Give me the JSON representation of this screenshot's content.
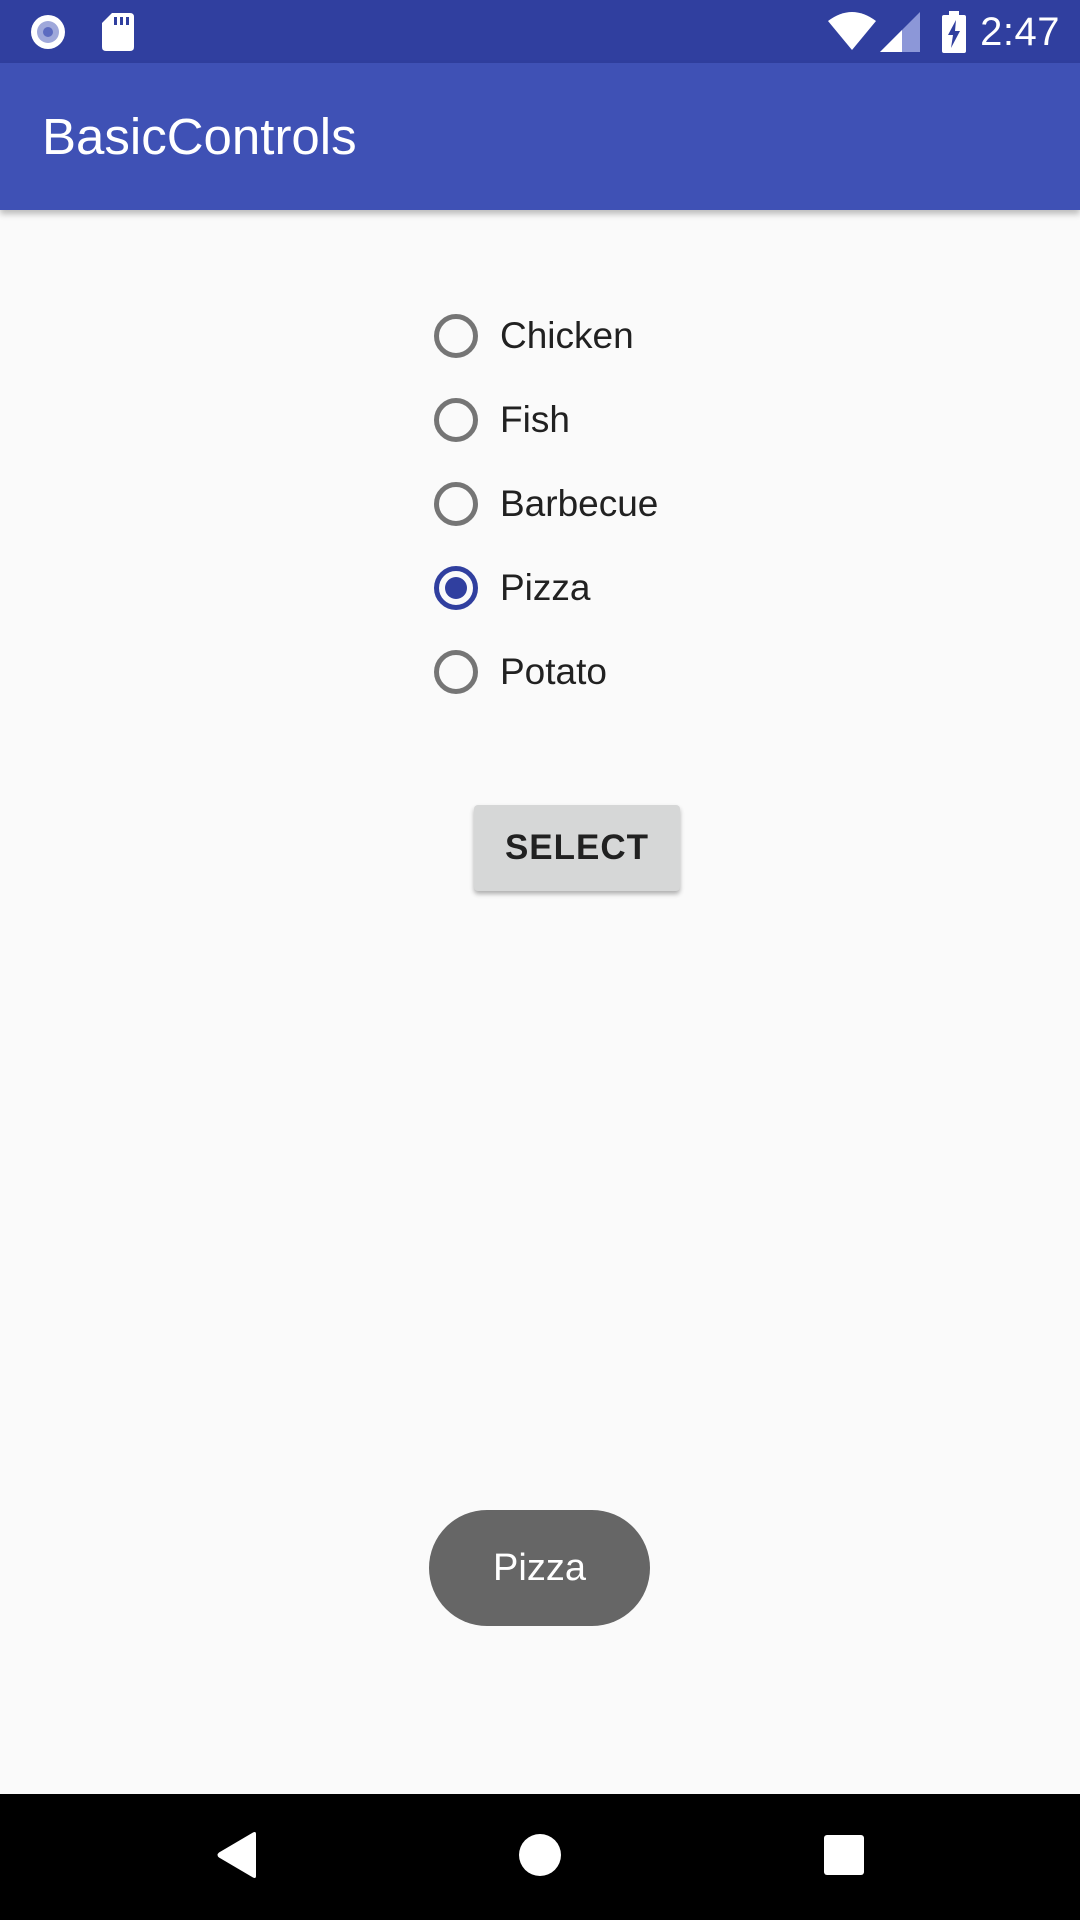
{
  "status_bar": {
    "time": "2:47",
    "icons": [
      "record-icon",
      "sd-card-icon",
      "wifi-icon",
      "cell-signal-icon",
      "battery-charging-icon"
    ],
    "color": "#303f9f"
  },
  "app_bar": {
    "title": "BasicControls",
    "color": "#3f51b5"
  },
  "radio_group": {
    "options": [
      {
        "label": "Chicken",
        "checked": false
      },
      {
        "label": "Fish",
        "checked": false
      },
      {
        "label": "Barbecue",
        "checked": false
      },
      {
        "label": "Pizza",
        "checked": true
      },
      {
        "label": "Potato",
        "checked": false
      }
    ],
    "accent_color": "#303f9f"
  },
  "select_button": {
    "label": "SELECT"
  },
  "toast": {
    "message": "Pizza"
  },
  "nav_bar": {
    "buttons": [
      "back-icon",
      "home-icon",
      "recents-icon"
    ]
  }
}
